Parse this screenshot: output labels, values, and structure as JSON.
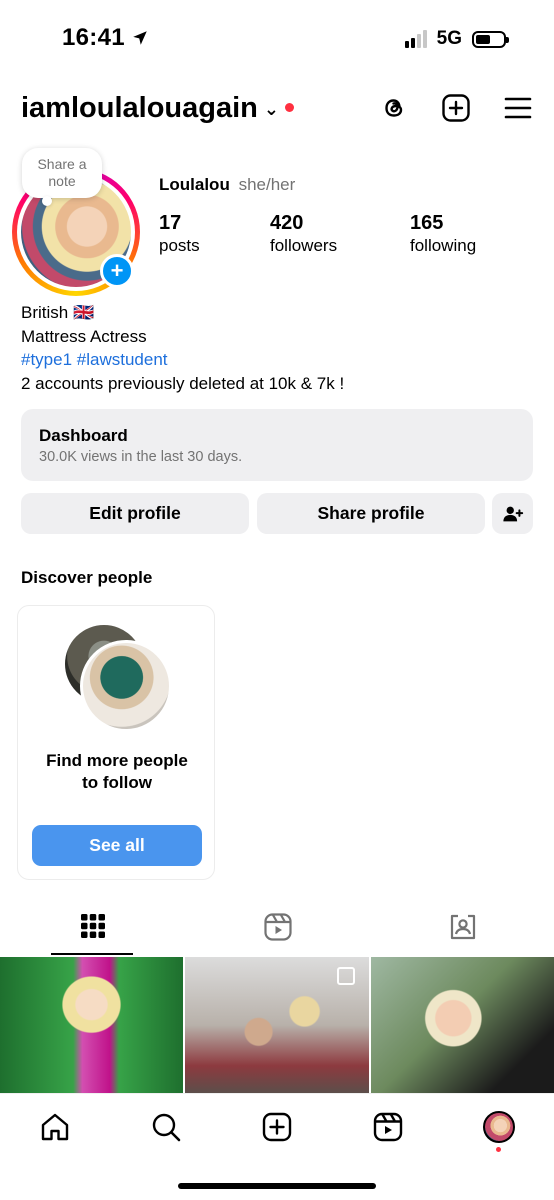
{
  "status_bar": {
    "time": "16:41",
    "network": "5G"
  },
  "header": {
    "username": "iamloulalouagain"
  },
  "profile": {
    "note_text": "Share a note",
    "name": "Loulalou",
    "pronouns": "she/her",
    "stats": [
      {
        "value": "17",
        "label": "posts"
      },
      {
        "value": "420",
        "label": "followers"
      },
      {
        "value": "165",
        "label": "following"
      }
    ],
    "bio": {
      "line1": "British 🇬🇧",
      "line2": "Mattress Actress",
      "tags": "#type1 #lawstudent",
      "line4": "2 accounts previously deleted at 10k & 7k !"
    }
  },
  "dashboard": {
    "title": "Dashboard",
    "subtitle": "30.0K views in the last 30 days."
  },
  "buttons": {
    "edit_profile": "Edit profile",
    "share_profile": "Share profile"
  },
  "discover": {
    "title": "Discover people",
    "card_text_1": "Find more people",
    "card_text_2": "to follow",
    "see_all": "See all"
  },
  "icons": {
    "header": [
      "threads-icon",
      "plus-square-icon",
      "menu-icon"
    ],
    "tabs": [
      "grid-icon",
      "reels-icon",
      "tagged-icon"
    ],
    "nav": [
      "home-icon",
      "search-icon",
      "create-icon",
      "reels-icon",
      "profile-avatar"
    ]
  },
  "colors": {
    "accent": "#0095f6",
    "link": "#1d6fdc",
    "notification": "#ff3040",
    "button_bg": "#efeff1"
  }
}
